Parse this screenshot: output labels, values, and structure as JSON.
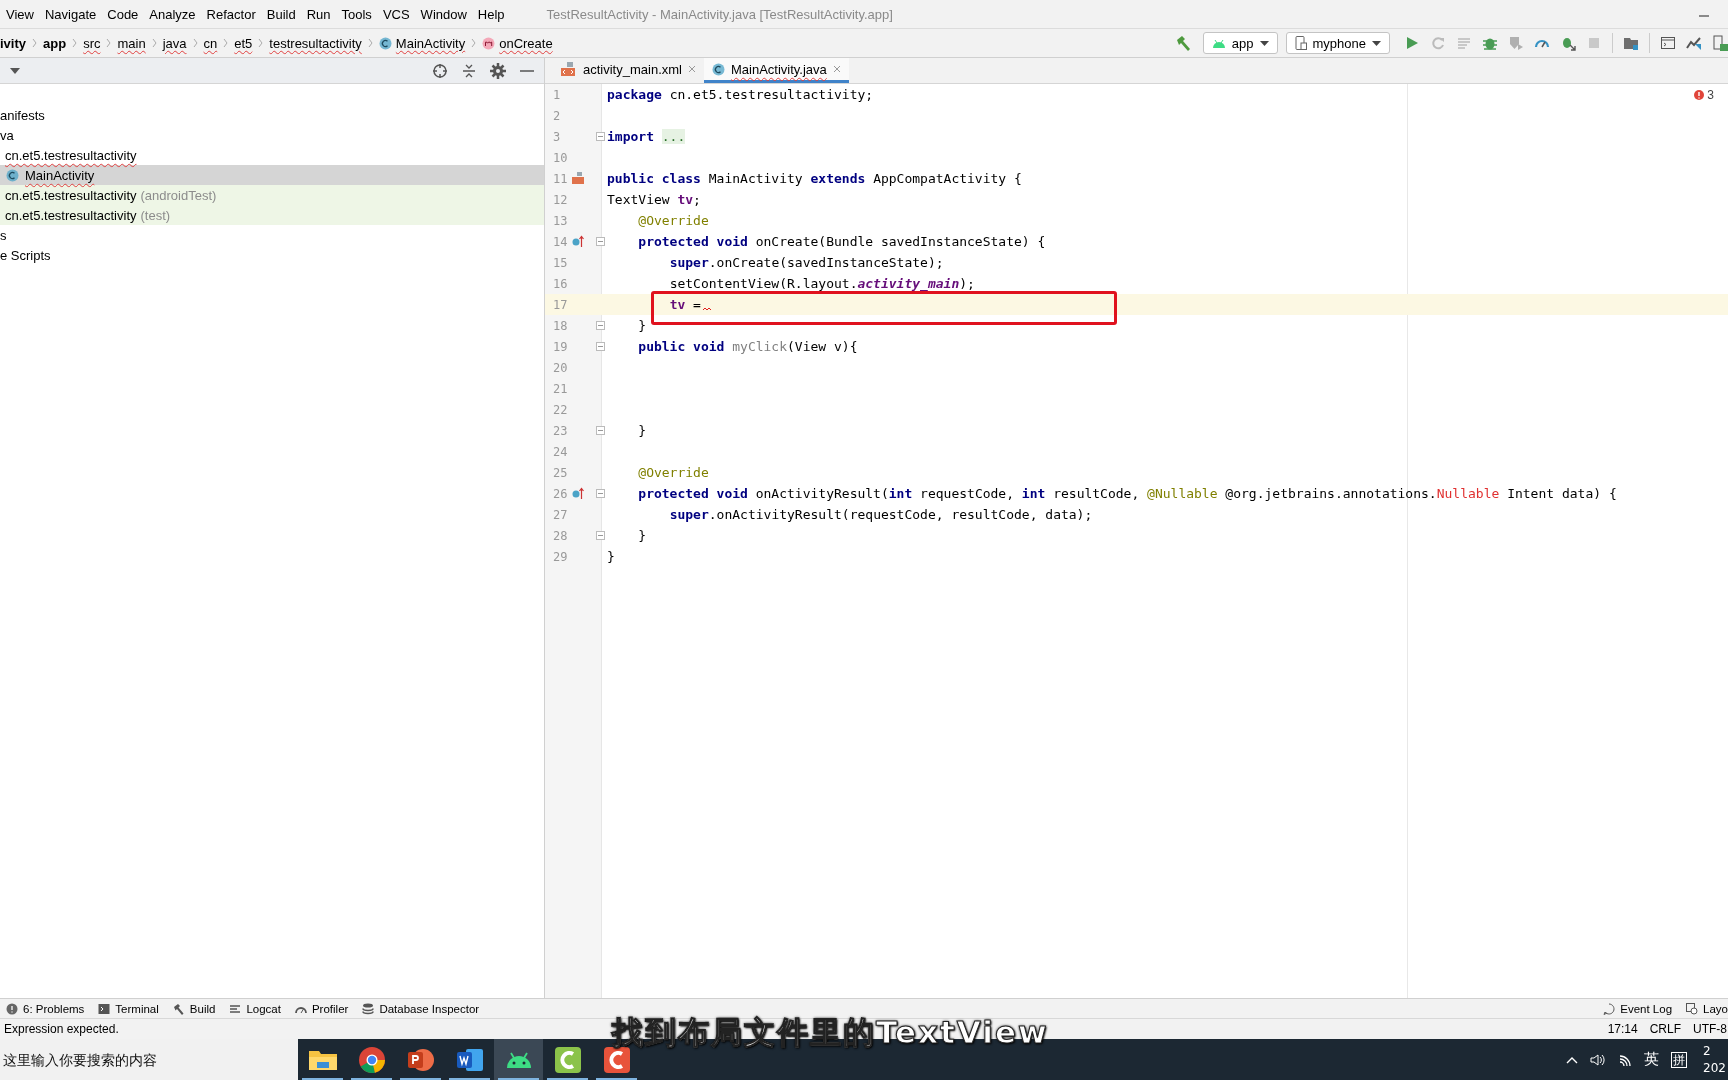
{
  "window": {
    "title": "TestResultActivity - MainActivity.java [TestResultActivity.app]"
  },
  "menu": [
    "View",
    "Navigate",
    "Code",
    "Analyze",
    "Refactor",
    "Build",
    "Run",
    "Tools",
    "VCS",
    "Window",
    "Help"
  ],
  "breadcrumbs": [
    {
      "label": "ivity",
      "kind": "bold"
    },
    {
      "label": "app",
      "kind": "bold"
    },
    {
      "label": "src",
      "kind": "plain"
    },
    {
      "label": "main",
      "kind": "plain"
    },
    {
      "label": "java",
      "kind": "plain"
    },
    {
      "label": "cn",
      "kind": "plain"
    },
    {
      "label": "et5",
      "kind": "plain"
    },
    {
      "label": "testresultactivity",
      "kind": "plain"
    },
    {
      "label": "MainActivity",
      "kind": "class"
    },
    {
      "label": "onCreate",
      "kind": "method"
    }
  ],
  "run_config": {
    "module": "app",
    "device": "myphone"
  },
  "project_tree": [
    {
      "label": "anifests",
      "kind": "folder",
      "selected": false
    },
    {
      "label": "va",
      "kind": "folder",
      "selected": false
    },
    {
      "label": "cn.et5.testresultactivity",
      "kind": "package",
      "selected": false
    },
    {
      "label": "MainActivity",
      "kind": "class",
      "selected": true
    },
    {
      "label": "cn.et5.testresultactivity",
      "suffix": "(androidTest)",
      "kind": "test-package",
      "selected": false
    },
    {
      "label": "cn.et5.testresultactivity",
      "suffix": "(test)",
      "kind": "test-package",
      "selected": false
    },
    {
      "label": "s",
      "kind": "folder",
      "selected": false
    },
    {
      "label": "e Scripts",
      "kind": "folder",
      "selected": false
    }
  ],
  "editor_tabs": [
    {
      "label": "activity_main.xml",
      "kind": "xml",
      "selected": false
    },
    {
      "label": "MainActivity.java",
      "kind": "class",
      "selected": true
    }
  ],
  "error_count": "3",
  "code_lines": [
    {
      "number": "1",
      "kind": "plain",
      "current": false,
      "fold": false,
      "boxed": false,
      "error": false,
      "tokens": [
        {
          "text": "package",
          "kind": "keyword"
        },
        {
          "text": " cn.et5.testresultactivity;",
          "kind": "plain"
        }
      ]
    },
    {
      "number": "2",
      "kind": "plain",
      "current": false,
      "fold": false,
      "boxed": false,
      "error": false
    },
    {
      "number": "3",
      "kind": "plain",
      "current": false,
      "fold": true,
      "boxed": false,
      "error": false,
      "tokens": [
        {
          "text": "import",
          "kind": "keyword"
        },
        {
          "text": " ...",
          "kind": "folded"
        }
      ]
    },
    {
      "number": "10",
      "kind": "plain",
      "current": false,
      "fold": false,
      "boxed": false,
      "error": false
    },
    {
      "number": "11",
      "kind": "layout",
      "current": false,
      "fold": false,
      "boxed": false,
      "error": false,
      "tokens": [
        {
          "text": "public class",
          "kind": "keyword"
        },
        {
          "text": " MainActivity ",
          "kind": "plain"
        },
        {
          "text": "extends",
          "kind": "keyword"
        },
        {
          "text": " AppCompatActivity {",
          "kind": "plain"
        }
      ]
    },
    {
      "number": "12",
      "kind": "plain",
      "current": false,
      "fold": false,
      "boxed": false,
      "error": false,
      "tokens": [
        {
          "text": "TextView ",
          "kind": "plain"
        },
        {
          "text": "tv",
          "kind": "field"
        },
        {
          "text": ";",
          "kind": "plain"
        }
      ]
    },
    {
      "number": "13",
      "kind": "plain",
      "current": false,
      "fold": false,
      "boxed": false,
      "error": false,
      "tokens": [
        {
          "text": "    @Override",
          "kind": "annotation"
        }
      ]
    },
    {
      "number": "14",
      "kind": "override",
      "current": false,
      "fold": true,
      "boxed": false,
      "error": false,
      "tokens": [
        {
          "text": "    protected void",
          "kind": "keyword"
        },
        {
          "text": " onCreate(Bundle savedInstanceState) {",
          "kind": "plain"
        }
      ]
    },
    {
      "number": "15",
      "kind": "plain",
      "current": false,
      "fold": false,
      "boxed": false,
      "error": false,
      "tokens": [
        {
          "text": "        super",
          "kind": "keyword"
        },
        {
          "text": ".onCreate(savedInstanceState);",
          "kind": "plain"
        }
      ]
    },
    {
      "number": "16",
      "kind": "plain",
      "current": false,
      "fold": false,
      "boxed": false,
      "error": false,
      "tokens": [
        {
          "text": "        setContentView(R.layout.",
          "kind": "plain"
        },
        {
          "text": "activity_main",
          "kind": "static"
        },
        {
          "text": ");",
          "kind": "plain"
        }
      ]
    },
    {
      "number": "17",
      "kind": "plain",
      "current": true,
      "fold": false,
      "boxed": true,
      "error": true,
      "tokens": [
        {
          "text": "        tv",
          "kind": "field"
        },
        {
          "text": " =",
          "kind": "plain"
        }
      ]
    },
    {
      "number": "18",
      "kind": "plain",
      "current": false,
      "fold": true,
      "boxed": false,
      "error": false,
      "tokens": [
        {
          "text": "    }",
          "kind": "plain"
        }
      ]
    },
    {
      "number": "19",
      "kind": "plain",
      "current": false,
      "fold": true,
      "boxed": false,
      "error": false,
      "tokens": [
        {
          "text": "    public void",
          "kind": "keyword"
        },
        {
          "text": " myClick",
          "kind": "unused"
        },
        {
          "text": "(View v){",
          "kind": "plain"
        }
      ]
    },
    {
      "number": "20",
      "kind": "plain",
      "current": false,
      "fold": false,
      "boxed": false,
      "error": false
    },
    {
      "number": "21",
      "kind": "plain",
      "current": false,
      "fold": false,
      "boxed": false,
      "error": false
    },
    {
      "number": "22",
      "kind": "plain",
      "current": false,
      "fold": false,
      "boxed": false,
      "error": false
    },
    {
      "number": "23",
      "kind": "plain",
      "current": false,
      "fold": true,
      "boxed": false,
      "error": false,
      "tokens": [
        {
          "text": "    }",
          "kind": "plain"
        }
      ]
    },
    {
      "number": "24",
      "kind": "plain",
      "current": false,
      "fold": false,
      "boxed": false,
      "error": false
    },
    {
      "number": "25",
      "kind": "plain",
      "current": false,
      "fold": false,
      "boxed": false,
      "error": false,
      "tokens": [
        {
          "text": "    @Override",
          "kind": "annotation"
        }
      ]
    },
    {
      "number": "26",
      "kind": "override",
      "current": false,
      "fold": true,
      "boxed": false,
      "error": false,
      "tokens": [
        {
          "text": "    protected void",
          "kind": "keyword"
        },
        {
          "text": " onActivityResult(",
          "kind": "plain"
        },
        {
          "text": "int",
          "kind": "keyword"
        },
        {
          "text": " requestCode, ",
          "kind": "plain"
        },
        {
          "text": "int",
          "kind": "keyword"
        },
        {
          "text": " resultCode, ",
          "kind": "plain"
        },
        {
          "text": "@Nullable",
          "kind": "annotation"
        },
        {
          "text": " @org.jetbrains.annotations.",
          "kind": "plain"
        },
        {
          "text": "Nullable",
          "kind": "error"
        },
        {
          "text": " Intent data) {",
          "kind": "plain"
        }
      ]
    },
    {
      "number": "27",
      "kind": "plain",
      "current": false,
      "fold": false,
      "boxed": false,
      "error": false,
      "tokens": [
        {
          "text": "        super",
          "kind": "keyword"
        },
        {
          "text": ".onActivityResult(requestCode, resultCode, data);",
          "kind": "plain"
        }
      ]
    },
    {
      "number": "28",
      "kind": "plain",
      "current": false,
      "fold": true,
      "boxed": false,
      "error": false,
      "tokens": [
        {
          "text": "    }",
          "kind": "plain"
        }
      ]
    },
    {
      "number": "29",
      "kind": "plain",
      "current": false,
      "fold": false,
      "boxed": false,
      "error": false,
      "tokens": [
        {
          "text": "}",
          "kind": "plain"
        }
      ]
    }
  ],
  "tool_windows": [
    {
      "label": "6: Problems",
      "kind": "problems"
    },
    {
      "label": "Terminal",
      "kind": "terminal"
    },
    {
      "label": "Build",
      "kind": "build"
    },
    {
      "label": "Logcat",
      "kind": "logcat"
    },
    {
      "label": "Profiler",
      "kind": "profiler"
    },
    {
      "label": "Database Inspector",
      "kind": "database"
    }
  ],
  "tool_windows_right": [
    {
      "label": "Event Log",
      "kind": "eventlog"
    },
    {
      "label": "Layo",
      "kind": "layout"
    }
  ],
  "status_bar": {
    "message": "Expression expected.",
    "position": "17:14",
    "line_separator": "CRLF",
    "encoding": "UTF-8"
  },
  "taskbar": {
    "search": {
      "placeholder": "这里输入你要搜索的内容"
    },
    "apps": [
      {
        "kind": "folder",
        "selected": false
      },
      {
        "kind": "browser",
        "selected": false
      },
      {
        "kind": "presentation",
        "selected": false
      },
      {
        "kind": "document",
        "selected": false
      },
      {
        "kind": "android",
        "selected": true
      },
      {
        "kind": "recorder",
        "selected": false
      },
      {
        "kind": "editor",
        "selected": false
      }
    ],
    "input_language": "英",
    "input_method": "拼",
    "clock": [
      "2",
      "202"
    ]
  },
  "subtitle": "找到布局文件里的TextView"
}
